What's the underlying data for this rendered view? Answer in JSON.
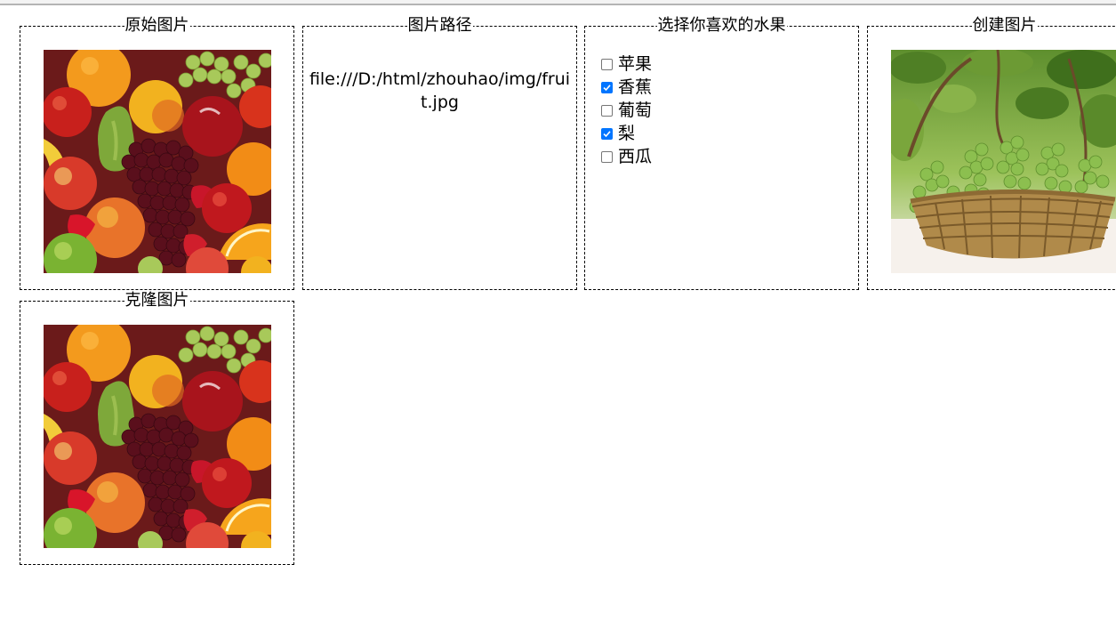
{
  "panels": {
    "original": {
      "title": "原始图片",
      "image_alt": "fruit.jpg"
    },
    "path": {
      "title": "图片路径",
      "path_text": "file:///D:/html/zhouhao/img/fruit.jpg"
    },
    "fruits": {
      "title": "选择你喜欢的水果",
      "items": [
        {
          "label": "苹果",
          "checked": false
        },
        {
          "label": "香蕉",
          "checked": true
        },
        {
          "label": "葡萄",
          "checked": false
        },
        {
          "label": "梨",
          "checked": true
        },
        {
          "label": "西瓜",
          "checked": false
        }
      ]
    },
    "created": {
      "title": "创建图片"
    },
    "cloned": {
      "title": "克隆图片"
    }
  },
  "colors": {
    "checkbox_checked": "#0075ff",
    "border": "#000000"
  }
}
